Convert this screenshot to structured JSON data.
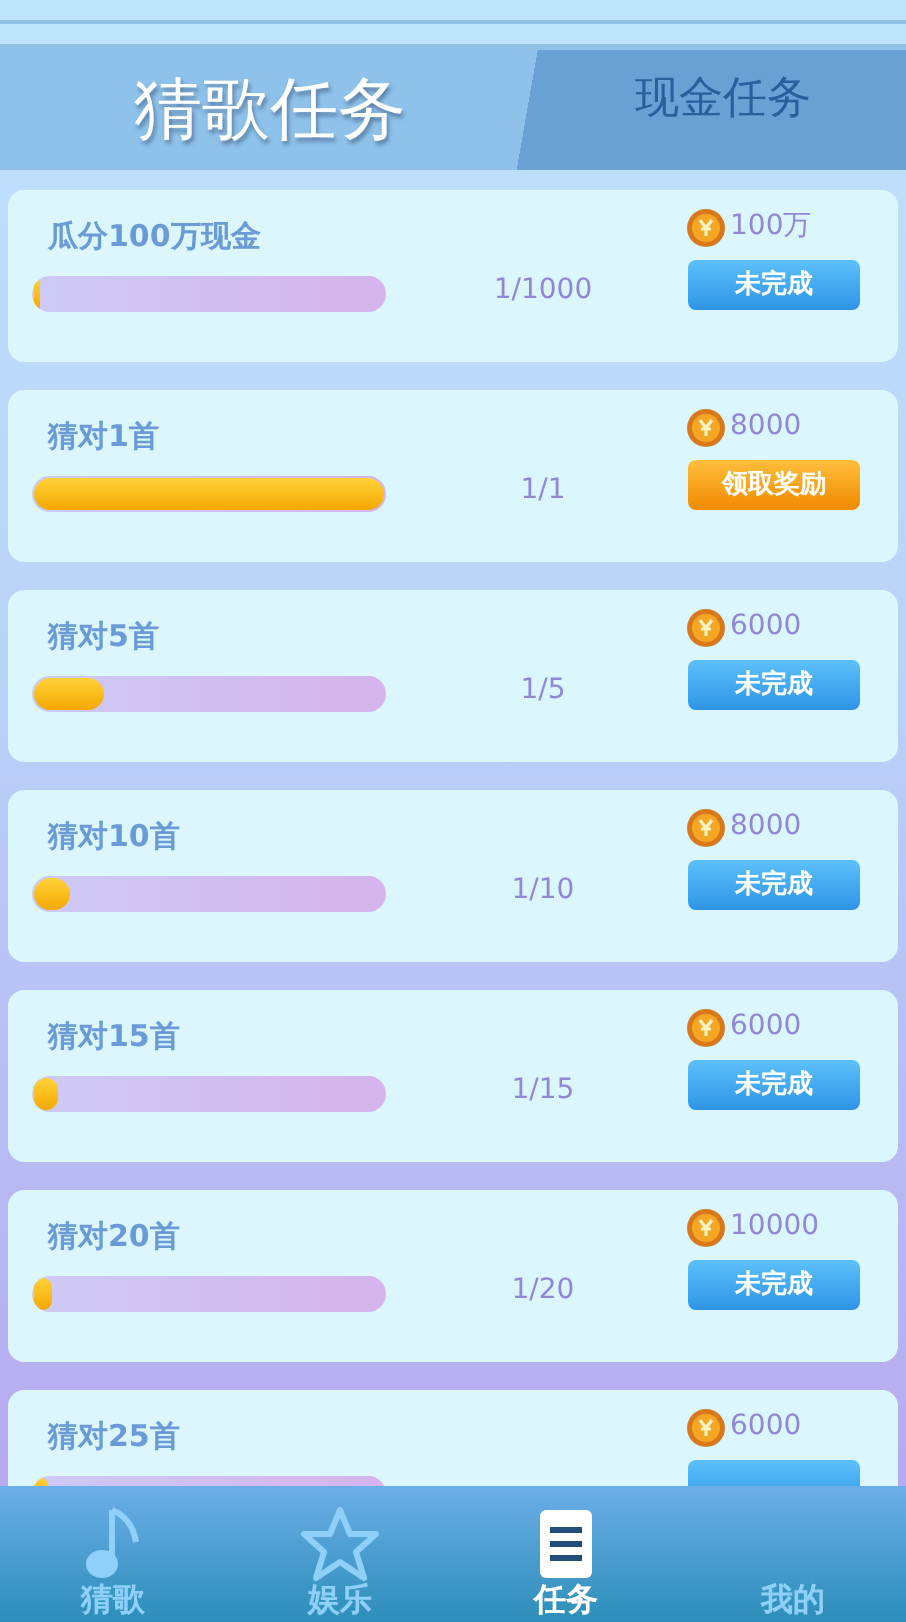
{
  "header": {
    "tabs": [
      {
        "label": "猜歌任务",
        "selected": true
      },
      {
        "label": "现金任务",
        "selected": false
      }
    ]
  },
  "tasks": [
    {
      "title": "瓜分100万现金",
      "level": 0.001,
      "count": "1/1000",
      "reward": "100万",
      "button": {
        "kind": "pending",
        "label": "未完成"
      }
    },
    {
      "title": "猜对1首",
      "level": 1,
      "count": "1/1",
      "reward": "8000",
      "button": {
        "kind": "claim",
        "label": "领取奖励"
      }
    },
    {
      "title": "猜对5首",
      "level": 0.2,
      "count": "1/5",
      "reward": "6000",
      "button": {
        "kind": "pending",
        "label": "未完成"
      }
    },
    {
      "title": "猜对10首",
      "level": 0.1,
      "count": "1/10",
      "reward": "8000",
      "button": {
        "kind": "pending",
        "label": "未完成"
      }
    },
    {
      "title": "猜对15首",
      "level": 0.067,
      "count": "1/15",
      "reward": "6000",
      "button": {
        "kind": "pending",
        "label": "未完成"
      }
    },
    {
      "title": "猜对20首",
      "level": 0.05,
      "count": "1/20",
      "reward": "10000",
      "button": {
        "kind": "pending",
        "label": "未完成"
      }
    },
    {
      "title": "猜对25首",
      "level": 0.04,
      "reward": "6000",
      "button": {
        "kind": "pending"
      }
    }
  ],
  "tab_bar": [
    {
      "label": "猜歌",
      "kind": "note",
      "selected": false
    },
    {
      "label": "娱乐",
      "kind": "star",
      "selected": false
    },
    {
      "label": "任务",
      "kind": "list",
      "selected": true
    },
    {
      "label": "我的",
      "selected": false
    }
  ]
}
